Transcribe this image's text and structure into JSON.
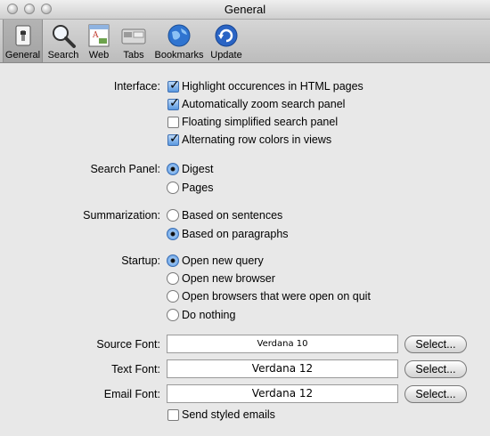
{
  "window": {
    "title": "General"
  },
  "toolbar": {
    "items": [
      {
        "label": "General",
        "icon": "switch-icon",
        "selected": true
      },
      {
        "label": "Search",
        "icon": "magnifier-icon"
      },
      {
        "label": "Web",
        "icon": "web-page-icon"
      },
      {
        "label": "Tabs",
        "icon": "tabs-icon"
      },
      {
        "label": "Bookmarks",
        "icon": "globe-icon"
      },
      {
        "label": "Update",
        "icon": "refresh-icon"
      }
    ]
  },
  "interface": {
    "label": "Interface:",
    "options": [
      {
        "label": "Highlight occurences in HTML pages",
        "checked": true
      },
      {
        "label": "Automatically zoom search panel",
        "checked": true
      },
      {
        "label": "Floating simplified search panel",
        "checked": false
      },
      {
        "label": "Alternating row colors in views",
        "checked": true
      }
    ]
  },
  "search_panel": {
    "label": "Search Panel:",
    "options": [
      {
        "label": "Digest",
        "selected": true
      },
      {
        "label": "Pages",
        "selected": false
      }
    ]
  },
  "summarization": {
    "label": "Summarization:",
    "options": [
      {
        "label": "Based on sentences",
        "selected": false
      },
      {
        "label": "Based on paragraphs",
        "selected": true
      }
    ]
  },
  "startup": {
    "label": "Startup:",
    "options": [
      {
        "label": "Open new query",
        "selected": true
      },
      {
        "label": "Open new browser",
        "selected": false
      },
      {
        "label": "Open browsers that were open on quit",
        "selected": false
      },
      {
        "label": "Do nothing",
        "selected": false
      }
    ]
  },
  "fonts": {
    "source": {
      "label": "Source Font:",
      "value": "Verdana 10",
      "button": "Select..."
    },
    "text": {
      "label": "Text Font:",
      "value": "Verdana 12",
      "button": "Select..."
    },
    "email": {
      "label": "Email Font:",
      "value": "Verdana 12",
      "button": "Select..."
    }
  },
  "send_styled": {
    "label": "Send styled emails",
    "checked": false
  },
  "colors": {
    "checkbox_on": "#5a98e0",
    "window_bg": "#e8e8e8"
  }
}
